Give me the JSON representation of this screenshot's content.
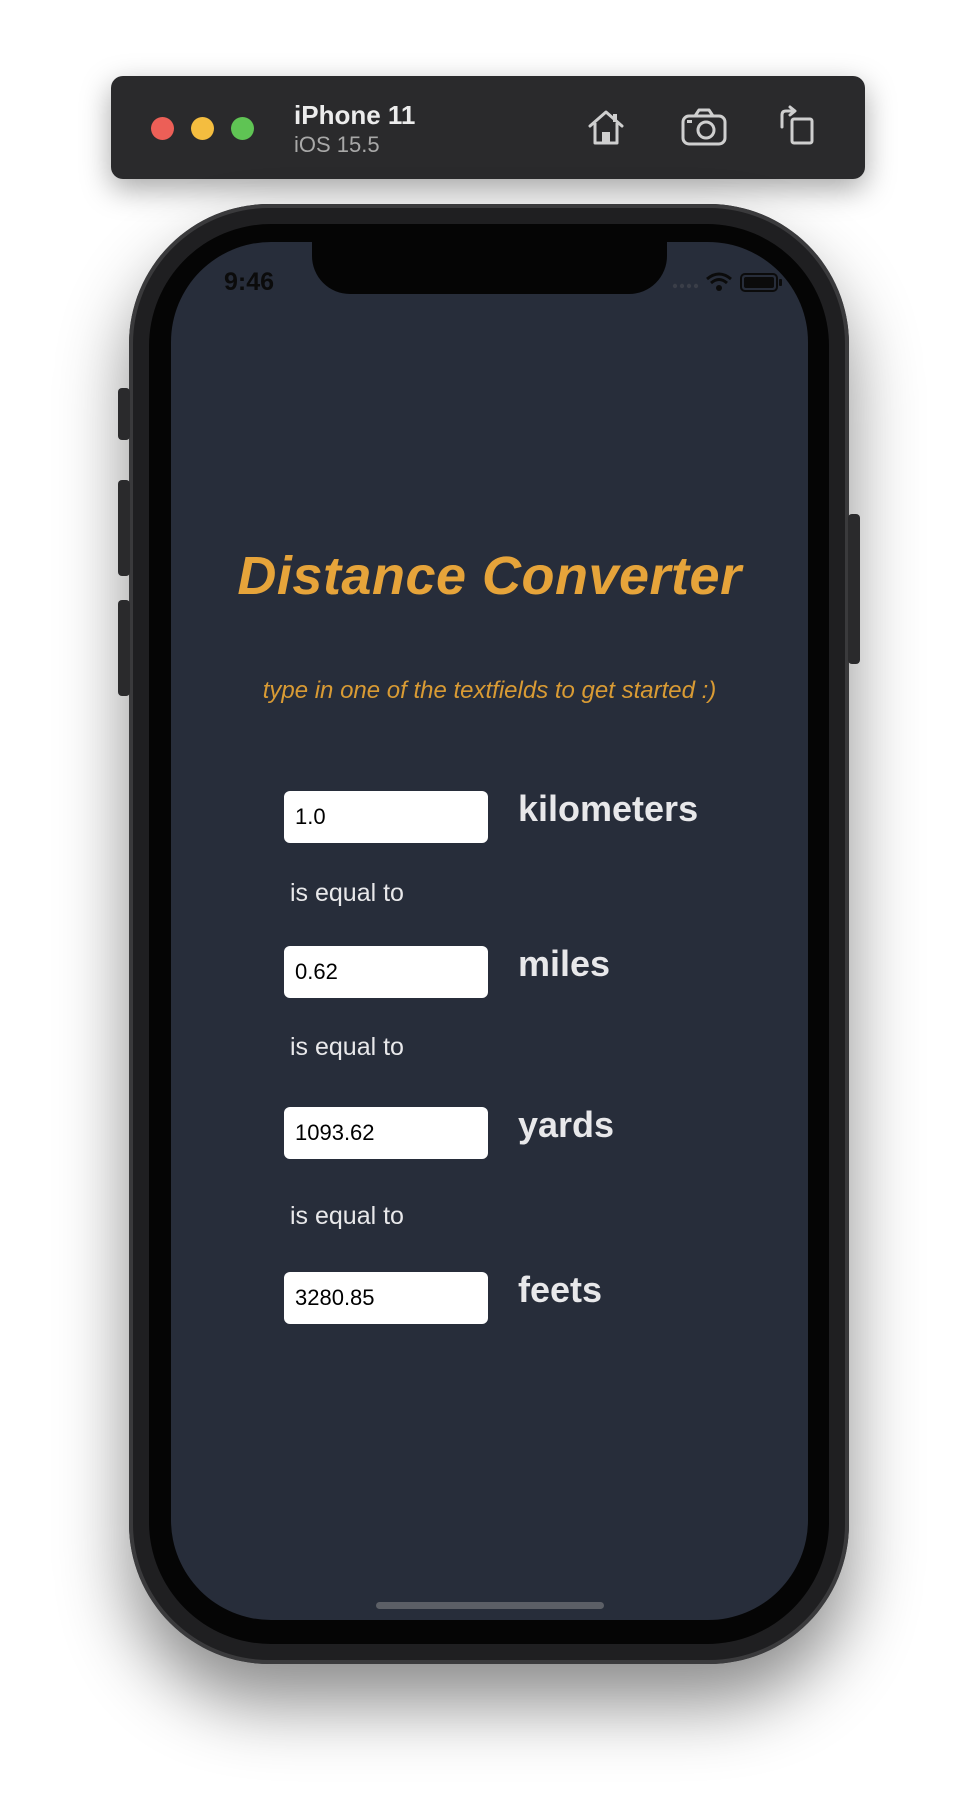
{
  "simulator": {
    "device_name": "iPhone 11",
    "os_version": "iOS 15.5",
    "buttons": {
      "home": "home-icon",
      "screenshot": "camera-icon",
      "rotate": "rotate-icon"
    }
  },
  "status_bar": {
    "time": "9:46"
  },
  "app": {
    "title": "Distance Converter",
    "subtitle": "type in one of the textfields to get started :)",
    "accent_color": "#e6a43a",
    "background_color": "#272d3a",
    "rows": [
      {
        "value": "1.0",
        "unit": "kilometers"
      },
      {
        "value": "0.62",
        "unit": "miles"
      },
      {
        "value": "1093.62",
        "unit": "yards"
      },
      {
        "value": "3280.85",
        "unit": "feets"
      }
    ],
    "separator_text": "is equal to"
  }
}
